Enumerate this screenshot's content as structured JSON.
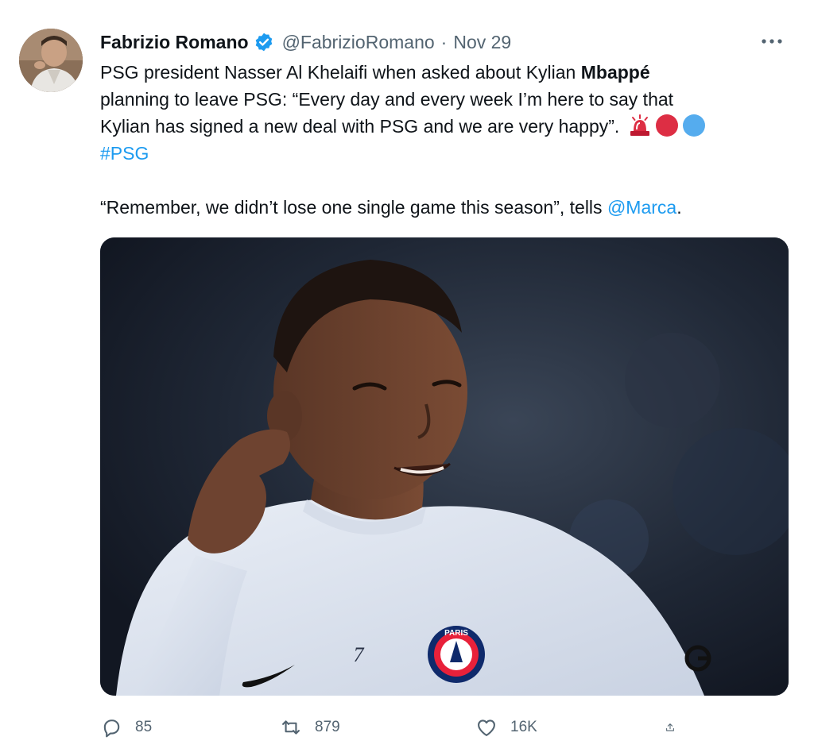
{
  "tweet": {
    "author": {
      "display_name": "Fabrizio Romano",
      "handle": "@FabrizioRomano",
      "verified": true
    },
    "separator": "·",
    "date": "Nov 29",
    "text": {
      "line1_prefix": "PSG president Nasser Al Khelaifi when asked about Kylian ",
      "line1_bold": "Mbappé",
      "line2": " planning to leave PSG: “Every day and every week I’m here to say that",
      "line3": "Kylian has signed a new deal with PSG and we are very happy”. ",
      "hashtag": "#PSG",
      "line5_prefix": "“Remember, we didn’t lose one single game this season”, tells ",
      "mention": "@Marca",
      "line5_suffix": "."
    },
    "emojis": [
      "police-light-emoji",
      "red-circle-emoji",
      "blue-circle-emoji"
    ],
    "media": {
      "jersey_number": "7",
      "crest_text": "PARIS"
    },
    "actions": {
      "replies": "85",
      "retweets": "879",
      "likes": "16K"
    }
  },
  "colors": {
    "link": "#1d9bf0",
    "secondary_text": "#536471",
    "verified": "#1d9bf0"
  }
}
